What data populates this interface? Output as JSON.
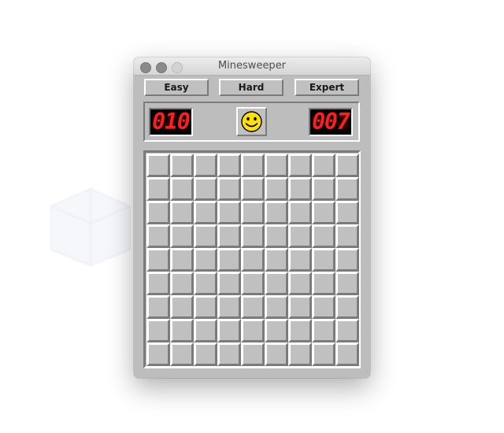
{
  "window": {
    "title": "Minesweeper",
    "traffic_lights": [
      "close",
      "minimize",
      "zoom"
    ]
  },
  "difficulty_buttons": [
    {
      "label": "Easy"
    },
    {
      "label": "Hard"
    },
    {
      "label": "Expert"
    }
  ],
  "status": {
    "mine_counter": {
      "display": "010",
      "value": 10
    },
    "timer": {
      "display": "007",
      "value": 7
    },
    "face": {
      "state": "smiling",
      "icon": "smiley-face-icon"
    }
  },
  "board": {
    "rows": 9,
    "cols": 9,
    "cells_state": "all-unrevealed"
  },
  "colors": {
    "window_bg": "#bdbdbd",
    "led_digits": "#ff1d1d",
    "led_bg": "#000000",
    "face": "#ffe000"
  }
}
